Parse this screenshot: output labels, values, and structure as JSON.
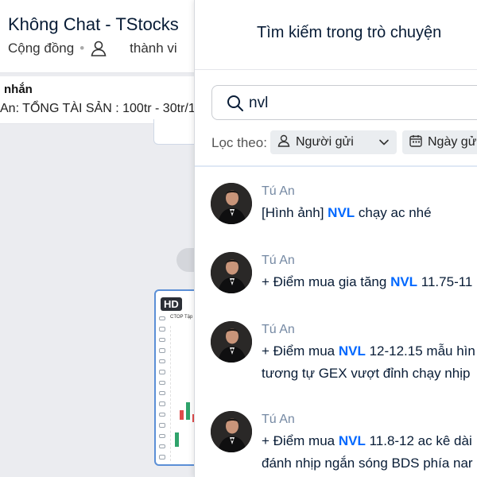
{
  "background_chat": {
    "title": "Không Chat - TStocks",
    "community_label": "Cộng đồng",
    "members_label": "thành vi",
    "pinned_heading": "nhắn",
    "pinned_text": "An: TỔNG TÀI SẢN : 100tr - 30tr/1",
    "image_badge": "HD",
    "chart_caption": "CTOP Tập"
  },
  "search_panel": {
    "title": "Tìm kiếm trong trò chuyện",
    "search": {
      "value": "nvl",
      "icon": "search-icon"
    },
    "filter": {
      "label": "Lọc theo:",
      "sender_label": "Người gửi",
      "date_label": "Ngày gửi"
    },
    "results": [
      {
        "sender": "Tú An",
        "lines": [
          {
            "before": "[Hình ảnh] ",
            "match": "NVL",
            "after": " chạy ac nhé"
          }
        ]
      },
      {
        "sender": "Tú An",
        "lines": [
          {
            "before": "+ Điểm mua gia tăng ",
            "match": "NVL",
            "after": " 11.75-11"
          }
        ]
      },
      {
        "sender": "Tú An",
        "lines": [
          {
            "before": "+ Điểm mua ",
            "match": "NVL",
            "after": " 12-12.15 mẫu hìn"
          },
          {
            "before": "tương tự GEX vượt đỉnh chạy nhịp",
            "match": "",
            "after": ""
          }
        ]
      },
      {
        "sender": "Tú An",
        "lines": [
          {
            "before": "+ Điểm mua ",
            "match": "NVL",
            "after": " 11.8-12 ac kê dài"
          },
          {
            "before": "đánh nhịp ngắn sóng BDS phía nar",
            "match": "",
            "after": ""
          }
        ]
      }
    ]
  },
  "colors": {
    "highlight": "#0068ff",
    "sender_name": "#7589a3",
    "text": "#081c36"
  }
}
